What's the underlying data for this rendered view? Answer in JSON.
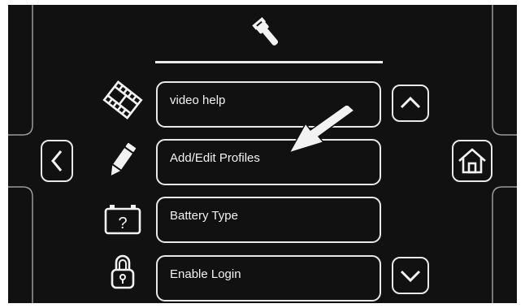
{
  "header": {
    "icon": "wrench-icon"
  },
  "menu": {
    "items": [
      {
        "label": "video help",
        "icon": "film-icon"
      },
      {
        "label": "Add/Edit Profiles",
        "icon": "pencil-icon"
      },
      {
        "label": "Battery Type",
        "icon": "battery-question-icon"
      },
      {
        "label": "Enable Login",
        "icon": "padlock-icon"
      }
    ]
  },
  "nav": {
    "up_icon": "chevron-up-icon",
    "down_icon": "chevron-down-icon"
  },
  "side": {
    "back_icon": "chevron-left-icon",
    "home_icon": "home-icon"
  },
  "annotation": {
    "icon": "arrow-icon",
    "target": "Add/Edit Profiles"
  },
  "colors": {
    "background": "#111111",
    "foreground": "#ececec"
  }
}
